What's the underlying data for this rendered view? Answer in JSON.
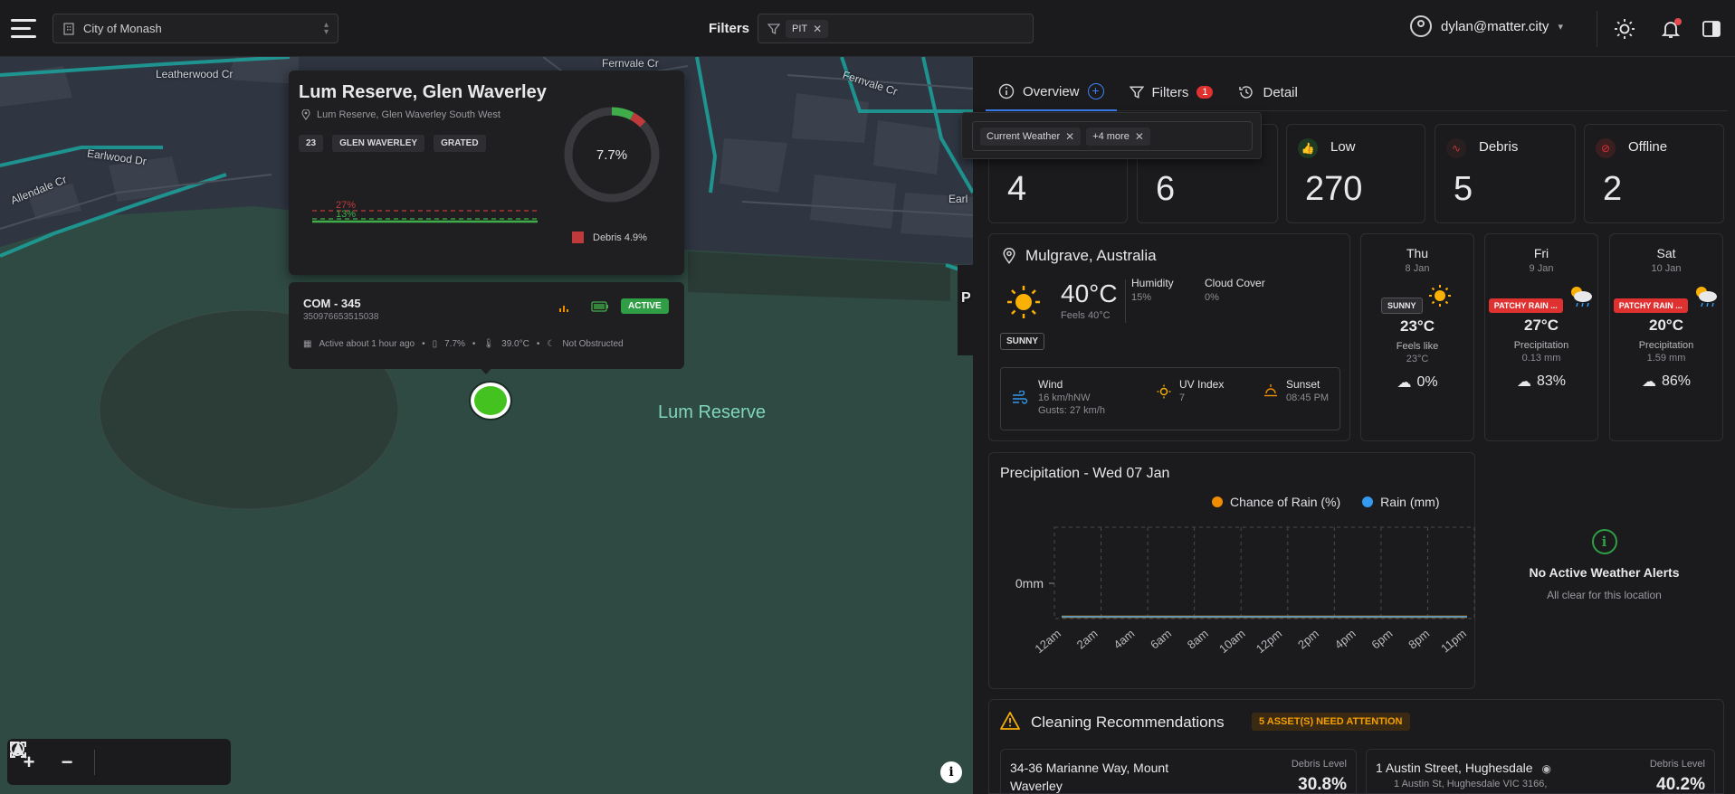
{
  "header": {
    "organization": "City of Monash",
    "filters_label": "Filters",
    "filter_chip": "PIT",
    "user_email": "dylan@matter.city"
  },
  "map": {
    "streets": [
      "Leatherwood Cr",
      "Fernvale Cr",
      "Fernvale Cr",
      "Earlwood Dr",
      "Allendale Cr",
      "Earl",
      "P"
    ],
    "park_label": "Lum Reserve",
    "controls": [
      "zoom-in",
      "zoom-out",
      "north",
      "fit",
      "locate"
    ]
  },
  "popup": {
    "title": "Lum Reserve, Glen Waverley",
    "address": "Lum Reserve, Glen Waverley South West",
    "tags": [
      "23",
      "GLEN WAVERLEY",
      "GRATED"
    ],
    "spark_high": "27%",
    "spark_low": "13%",
    "donut_value": "7.7%",
    "donut_fraction": 0.077,
    "legend": "Debris 4.9%",
    "device_id": "COM - 345",
    "serial": "350976653515038",
    "status": "ACTIVE",
    "last_active": "Active about 1 hour ago",
    "fill_level": "7.7%",
    "temperature": "39.0°C",
    "obstruction": "Not Obstructed"
  },
  "panel": {
    "tabs": [
      {
        "label": "Overview"
      },
      {
        "label": "Filters",
        "badge": "1"
      },
      {
        "label": "Detail"
      }
    ],
    "dropdown_chips": [
      "Current Weather",
      "+4 more"
    ],
    "stats": [
      {
        "label": "",
        "value": "4"
      },
      {
        "label": "",
        "value": "6"
      },
      {
        "label": "Low",
        "value": "270"
      },
      {
        "label": "Debris",
        "value": "5"
      },
      {
        "label": "Offline",
        "value": "2"
      }
    ],
    "weather": {
      "location": "Mulgrave, Australia",
      "temp": "40°C",
      "feels": "Feels 40°C",
      "humidity_label": "Humidity",
      "humidity": "15%",
      "cloud_label": "Cloud Cover",
      "cloud": "0%",
      "condition": "SUNNY",
      "wind_label": "Wind",
      "wind": "16 km/hNW",
      "gusts": "Gusts: 27 km/h",
      "uv_label": "UV Index",
      "uv": "7",
      "sunset_label": "Sunset",
      "sunset": "08:45 PM"
    },
    "forecast": [
      {
        "day": "Thu",
        "date": "8 Jan",
        "cond": "SUNNY",
        "temp": "23°C",
        "label": "Feels like",
        "val": "23°C",
        "rain": "0%"
      },
      {
        "day": "Fri",
        "date": "9 Jan",
        "cond": "PATCHY RAIN ...",
        "temp": "27°C",
        "label": "Precipitation",
        "val": "0.13 mm",
        "rain": "83%"
      },
      {
        "day": "Sat",
        "date": "10 Jan",
        "cond": "PATCHY RAIN ...",
        "temp": "20°C",
        "label": "Precipitation",
        "val": "1.59 mm",
        "rain": "86%"
      }
    ],
    "alerts": {
      "title": "No Active Weather Alerts",
      "subtitle": "All clear for this location"
    },
    "cleaning": {
      "title": "Cleaning Recommendations",
      "badge": "5 ASSET(S) NEED ATTENTION",
      "items": [
        {
          "address": "34-36 Marianne Way, Mount Waverley",
          "label": "Debris Level",
          "value": "30.8%"
        },
        {
          "address": "1 Austin Street, Hughesdale",
          "sub": "1 Austin St, Hughesdale VIC 3166,",
          "label": "Debris Level",
          "value": "40.2%"
        }
      ]
    }
  },
  "chart_data": {
    "type": "line",
    "title": "Precipitation - Wed 07 Jan",
    "categories": [
      "12am",
      "2am",
      "4am",
      "6am",
      "8am",
      "10am",
      "12pm",
      "2pm",
      "4pm",
      "6pm",
      "8pm",
      "11pm"
    ],
    "series": [
      {
        "name": "Chance of Rain (%)",
        "values": [
          0,
          0,
          0,
          0,
          0,
          0,
          0,
          0,
          0,
          0,
          0,
          0
        ],
        "color": "#f08c00"
      },
      {
        "name": "Rain (mm)",
        "values": [
          0,
          0,
          0,
          0,
          0,
          0,
          0,
          0,
          0,
          0,
          0,
          0
        ],
        "color": "#339af0"
      }
    ],
    "ytick": "0mm",
    "grid": true
  }
}
